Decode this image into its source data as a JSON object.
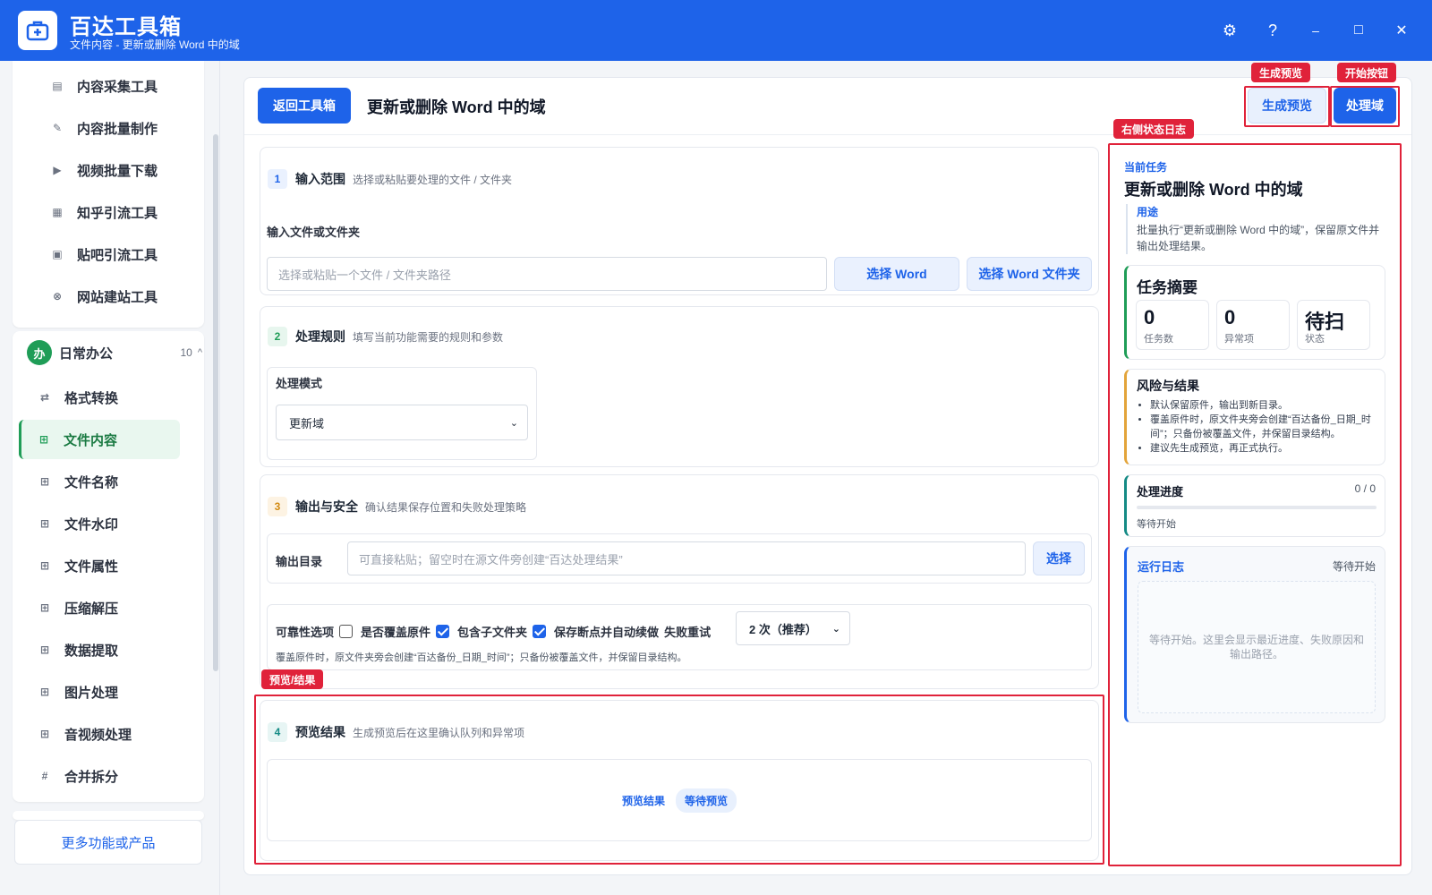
{
  "app": {
    "title": "百达工具箱",
    "subtitle": "文件内容 - 更新或删除 Word 中的域"
  },
  "window_controls": {
    "settings": "⚙",
    "help": "?",
    "minimize": "–",
    "maximize": "□",
    "close": "✕"
  },
  "sidebar": {
    "top_items": [
      {
        "label": "内容采集工具",
        "icon": "document-icon"
      },
      {
        "label": "内容批量制作",
        "icon": "pen-icon"
      },
      {
        "label": "视频批量下载",
        "icon": "video-icon"
      },
      {
        "label": "知乎引流工具",
        "icon": "zhihu-icon"
      },
      {
        "label": "贴吧引流工具",
        "icon": "message-icon"
      },
      {
        "label": "网站建站工具",
        "icon": "globe-icon"
      }
    ],
    "group": {
      "badge": "办",
      "label": "日常办公",
      "count": "10",
      "caret": "^"
    },
    "group_items": [
      {
        "label": "格式转换",
        "icon": "swap-icon",
        "active": false
      },
      {
        "label": "文件内容",
        "icon": "grid-icon",
        "active": true
      },
      {
        "label": "文件名称",
        "icon": "grid-icon",
        "active": false
      },
      {
        "label": "文件水印",
        "icon": "grid-icon",
        "active": false
      },
      {
        "label": "文件属性",
        "icon": "grid-icon",
        "active": false
      },
      {
        "label": "压缩解压",
        "icon": "grid-icon",
        "active": false
      },
      {
        "label": "数据提取",
        "icon": "grid-icon",
        "active": false
      },
      {
        "label": "图片处理",
        "icon": "grid-icon",
        "active": false
      },
      {
        "label": "音视频处理",
        "icon": "grid-icon",
        "active": false
      },
      {
        "label": "合并拆分",
        "icon": "hash-icon",
        "active": false
      }
    ],
    "more_button": "更多功能或产品"
  },
  "header": {
    "back_button": "返回工具箱",
    "page_title": "更新或删除 Word 中的域",
    "preview_button": "生成预览",
    "process_button": "处理域"
  },
  "sections": {
    "input": {
      "num": "1",
      "title": "输入范围",
      "desc": "选择或粘贴要处理的文件 / 文件夹",
      "field_label": "输入文件或文件夹",
      "placeholder": "选择或粘贴一个文件 / 文件夹路径",
      "btn_word": "选择 Word",
      "btn_folder": "选择 Word 文件夹"
    },
    "rules": {
      "num": "2",
      "title": "处理规则",
      "desc": "填写当前功能需要的规则和参数",
      "mode_label": "处理模式",
      "mode_value": "更新域"
    },
    "output": {
      "num": "3",
      "title": "输出与安全",
      "desc": "确认结果保存位置和失败处理策略",
      "dir_label": "输出目录",
      "dir_placeholder": "可直接粘贴；留空时在源文件旁创建“百达处理结果”",
      "dir_button": "选择",
      "reliability_label": "可靠性选项",
      "opt_overwrite": "是否覆盖原件",
      "opt_subfolders": "包含子文件夹",
      "opt_resume": "保存断点并自动续做",
      "retry_label": "失败重试",
      "retry_value": "2 次（推荐）",
      "note": "覆盖原件时，原文件夹旁会创建“百达备份_日期_时间”；只备份被覆盖文件，并保留目录结构。"
    },
    "preview": {
      "num": "4",
      "title": "预览结果",
      "desc": "生成预览后在这里确认队列和异常项",
      "result_label": "预览结果",
      "status_badge": "等待预览"
    }
  },
  "right_panel": {
    "current_task_label": "当前任务",
    "task_title": "更新或删除 Word 中的域",
    "purpose_label": "用途",
    "purpose_text": "批量执行“更新或删除 Word 中的域”，保留原文件并输出处理结果。",
    "summary_title": "任务摘要",
    "stats": [
      {
        "value": "0",
        "label": "任务数"
      },
      {
        "value": "0",
        "label": "异常项"
      },
      {
        "value": "待扫",
        "label": "状态"
      }
    ],
    "risk_title": "风险与结果",
    "risk_items": [
      "默认保留原件，输出到新目录。",
      "覆盖原件时，原文件夹旁会创建“百达备份_日期_时间”；只备份被覆盖文件，并保留目录结构。",
      "建议先生成预览，再正式执行。"
    ],
    "progress_title": "处理进度",
    "progress_count": "0 / 0",
    "progress_fraction": 0,
    "progress_status": "等待开始",
    "log_title": "运行日志",
    "log_status": "等待开始",
    "log_placeholder": "等待开始。这里会显示最近进度、失败原因和输出路径。"
  },
  "annotations": {
    "preview_tag": "生成预览",
    "start_tag": "开始按钮",
    "log_tag": "右侧状态日志",
    "result_tag": "预览/结果"
  },
  "colors": {
    "brand": "#1e63e9",
    "active_green": "#1f9d57",
    "annotation_red": "#e0223a",
    "risk_orange": "#e3a43a"
  }
}
